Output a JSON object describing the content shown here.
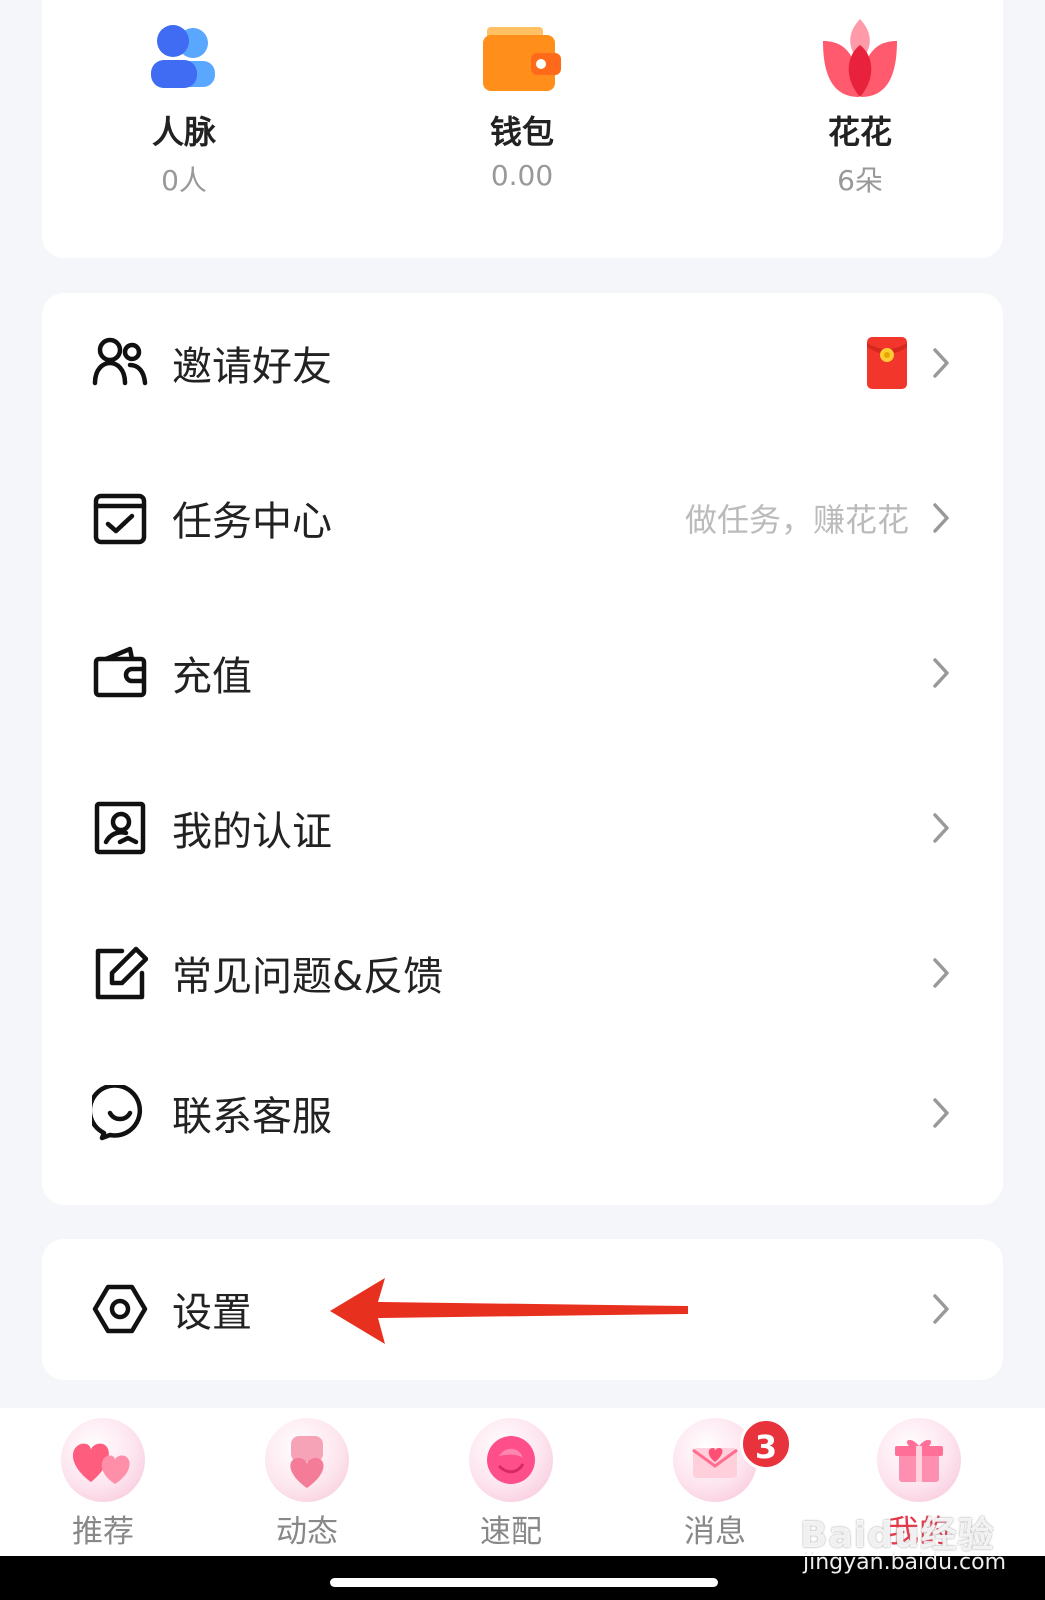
{
  "stats": [
    {
      "label": "人脉",
      "value": "0人",
      "icon": "contacts-icon"
    },
    {
      "label": "钱包",
      "value": "0.00",
      "icon": "wallet-icon"
    },
    {
      "label": "花花",
      "value": "6朵",
      "icon": "flower-icon"
    }
  ],
  "menu": [
    {
      "label": "邀请好友",
      "hint": "",
      "icon": "invite-friends-icon"
    },
    {
      "label": "任务中心",
      "hint": "做任务，赚花花",
      "icon": "task-checkbox-icon"
    },
    {
      "label": "充值",
      "hint": "",
      "icon": "wallet-outline-icon"
    },
    {
      "label": "我的认证",
      "hint": "",
      "icon": "verification-portrait-icon"
    },
    {
      "label": "常见问题&反馈",
      "hint": "",
      "icon": "edit-feedback-icon"
    },
    {
      "label": "联系客服",
      "hint": "",
      "icon": "chat-service-icon"
    }
  ],
  "settings": {
    "label": "设置",
    "icon": "settings-hexagon-icon"
  },
  "tabs": [
    {
      "label": "推荐",
      "icon": "hearts-icon"
    },
    {
      "label": "动态",
      "icon": "heart-box-icon"
    },
    {
      "label": "速配",
      "icon": "rose-icon"
    },
    {
      "label": "消息",
      "icon": "love-letter-icon",
      "badge": "3"
    },
    {
      "label": "我的",
      "icon": "gift-icon"
    }
  ],
  "watermark": {
    "brand": "Baidu经验",
    "url": "jingyan.baidu.com"
  },
  "colors": {
    "accent": "#e6374a",
    "badge": "#e8323c",
    "arrow": "#e8301f"
  }
}
